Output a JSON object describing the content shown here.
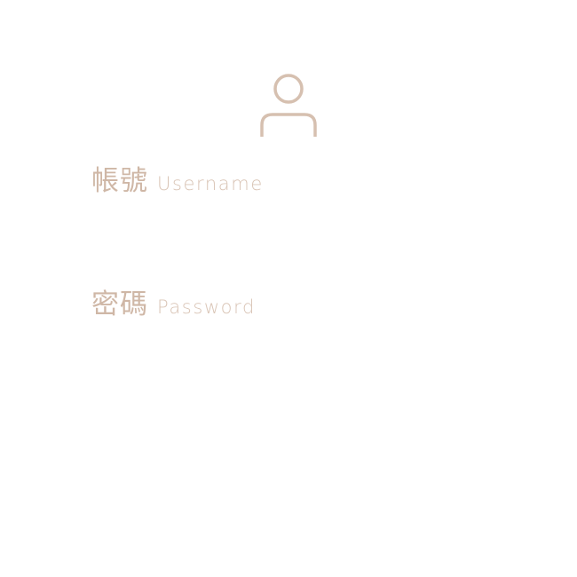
{
  "avatar": {
    "icon": "user-icon",
    "color": "#d6c0b0"
  },
  "username": {
    "label_zh": "帳號",
    "label_en": "Username",
    "value": "",
    "placeholder": ""
  },
  "password": {
    "label_zh": "密碼",
    "label_en": "Password",
    "value": "",
    "placeholder": ""
  },
  "colors": {
    "label_primary": "#cfb7a6",
    "label_secondary": "#d9c4b5",
    "background": "#ffffff"
  }
}
